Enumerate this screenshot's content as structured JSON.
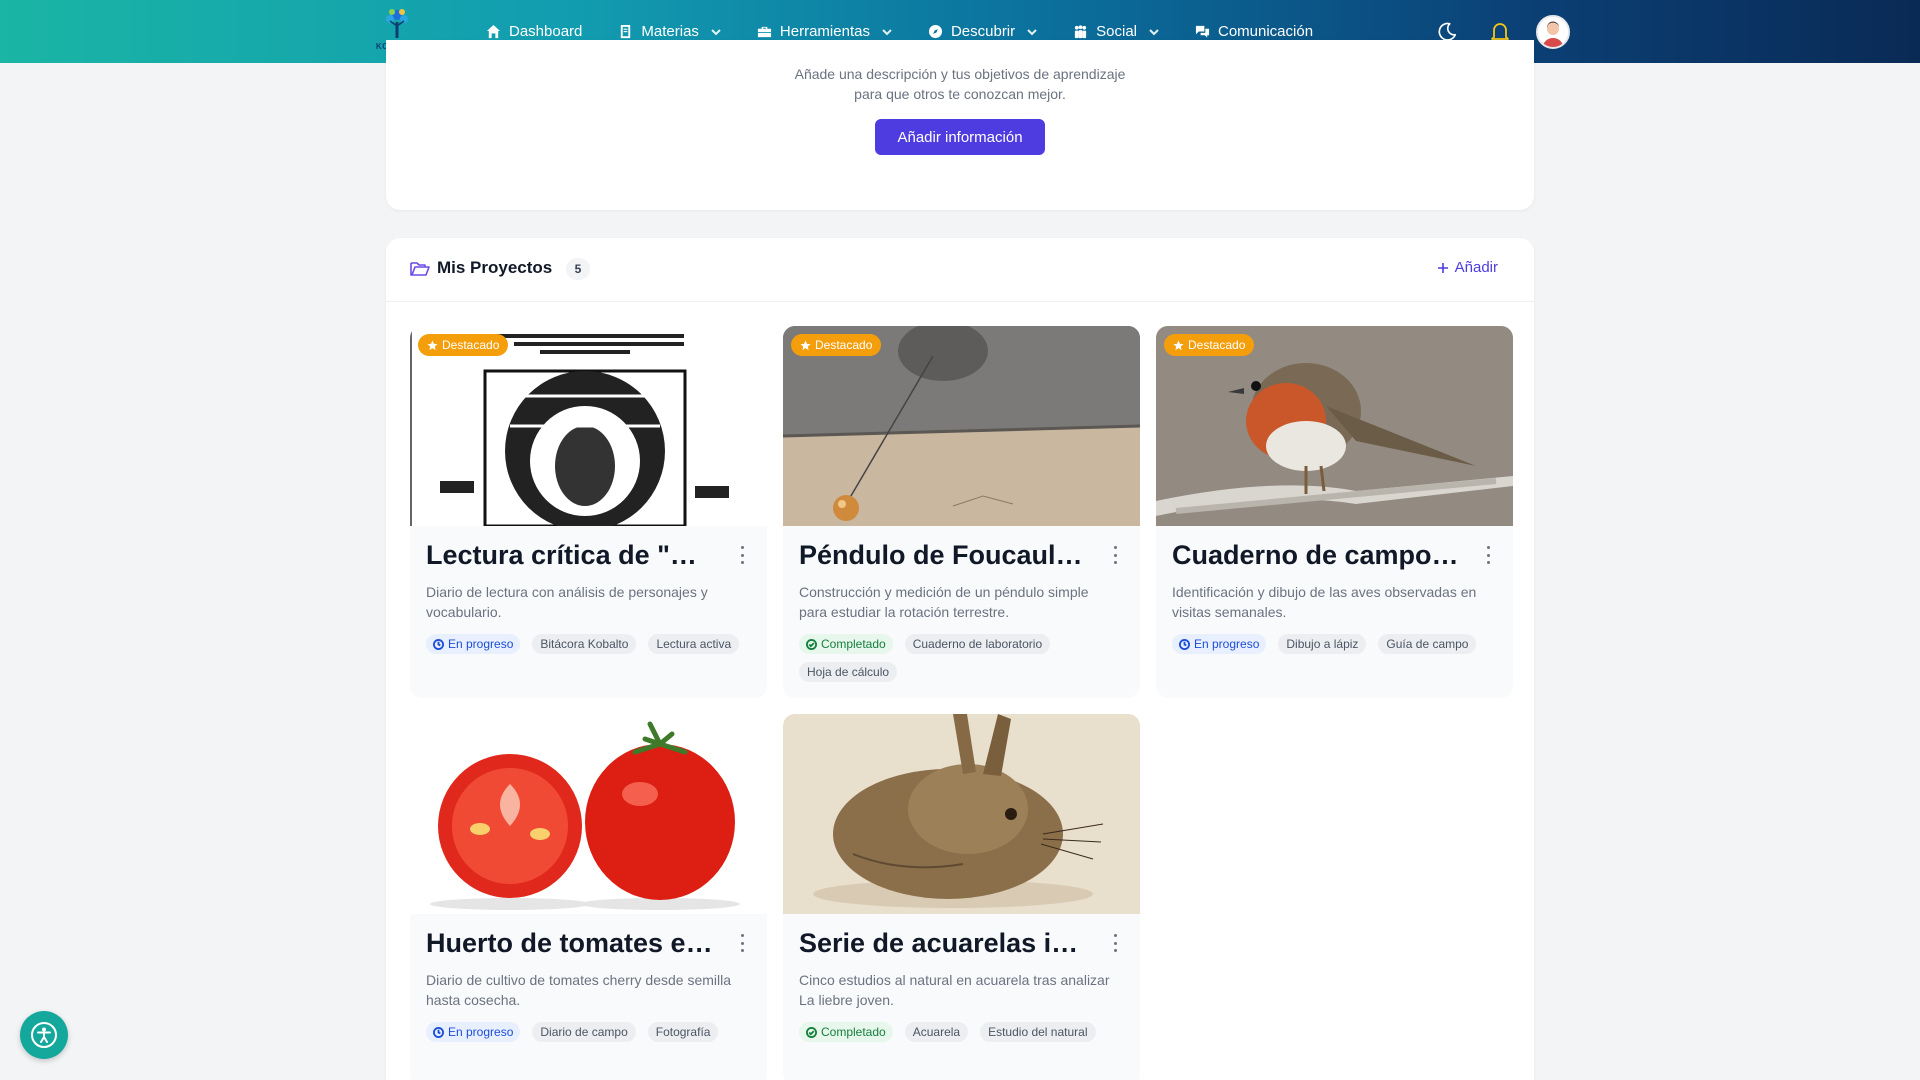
{
  "nav": {
    "logo_text": "KOBALTO",
    "items": [
      {
        "label": "Dashboard",
        "icon": "home-icon",
        "has_menu": false
      },
      {
        "label": "Materias",
        "icon": "book-icon",
        "has_menu": true
      },
      {
        "label": "Herramientas",
        "icon": "toolbox-icon",
        "has_menu": true
      },
      {
        "label": "Descubrir",
        "icon": "compass-icon",
        "has_menu": true
      },
      {
        "label": "Social",
        "icon": "users-icon",
        "has_menu": true
      },
      {
        "label": "Comunicación",
        "icon": "chat-icon",
        "has_menu": false
      }
    ]
  },
  "profile": {
    "description_line1": "Añade una descripción y tus objetivos de aprendizaje",
    "description_line2": "para que otros te conozcan mejor.",
    "add_info_label": "Añadir información"
  },
  "projects": {
    "title": "Mis Proyectos",
    "count": "5",
    "add_label": "Añadir",
    "featured_label": "Destacado",
    "cards": [
      {
        "title": "Lectura crítica de \"Don Quijote de la Mancha\"",
        "description": "Diario de lectura con análisis de personajes y vocabulario.",
        "status": "En progreso",
        "status_type": "progress",
        "featured": true,
        "image": "book-cover",
        "tags": [
          "Bitácora Kobalto",
          "Lectura activa"
        ]
      },
      {
        "title": "Péndulo de Foucault casero",
        "description": "Construcción y medición de un péndulo simple para estudiar la rotación terrestre.",
        "status": "Completado",
        "status_type": "done",
        "featured": true,
        "image": "pendulum",
        "tags": [
          "Cuaderno de laboratorio",
          "Hoja de cálculo"
        ]
      },
      {
        "title": "Cuaderno de campo de aves",
        "description": "Identificación y dibujo de las aves observadas en visitas semanales.",
        "status": "En progreso",
        "status_type": "progress",
        "featured": true,
        "image": "robin",
        "tags": [
          "Dibujo a lápiz",
          "Guía de campo"
        ]
      },
      {
        "title": "Huerto de tomates en balcón",
        "description": "Diario de cultivo de tomates cherry desde semilla hasta cosecha.",
        "status": "En progreso",
        "status_type": "progress",
        "featured": false,
        "image": "tomatoes",
        "tags": [
          "Diario de campo",
          "Fotografía"
        ]
      },
      {
        "title": "Serie de acuarelas inspiradas en Durero",
        "description": "Cinco estudios al natural en acuarela tras analizar La liebre joven.",
        "status": "Completado",
        "status_type": "done",
        "featured": false,
        "image": "hare",
        "tags": [
          "Acuarela",
          "Estudio del natural"
        ]
      }
    ]
  },
  "colors": {
    "accent": "#4f3ce0",
    "featured": "#f59e0b",
    "progress": "#1d4ed8",
    "done": "#15803d",
    "fab": "#14a89c"
  }
}
